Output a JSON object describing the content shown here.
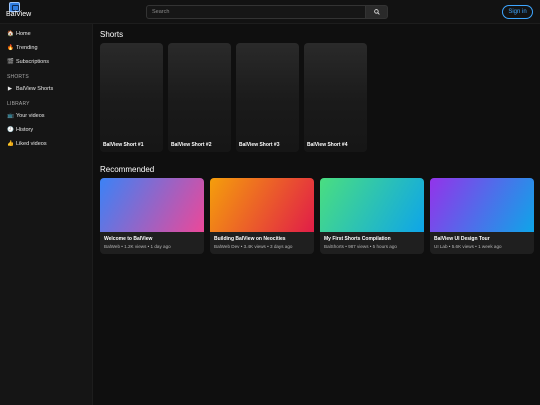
{
  "header": {
    "logo_text": "BalView",
    "search_placeholder": "Search",
    "signin_label": "Sign in"
  },
  "sidebar": {
    "items": [
      {
        "icon": "home-icon",
        "glyph": "🏠",
        "label": "Home"
      },
      {
        "icon": "fire-icon",
        "glyph": "🔥",
        "label": "Trending"
      },
      {
        "icon": "clapper-icon",
        "glyph": "🎬",
        "label": "Subscriptions"
      }
    ],
    "shorts_heading": "SHORTS",
    "shorts_items": [
      {
        "icon": "play-icon",
        "glyph": "▶",
        "label": "BalView Shorts"
      }
    ],
    "library_heading": "LIBRARY",
    "library_items": [
      {
        "icon": "tv-icon",
        "glyph": "📺",
        "label": "Your videos"
      },
      {
        "icon": "clock-icon",
        "glyph": "🕘",
        "label": "History"
      },
      {
        "icon": "thumbs-up-icon",
        "glyph": "👍",
        "label": "Liked videos"
      }
    ]
  },
  "main": {
    "shorts_title": "Shorts",
    "shorts": [
      {
        "title": "BalView Short #1"
      },
      {
        "title": "BalView Short #2"
      },
      {
        "title": "BalView Short #3"
      },
      {
        "title": "BalView Short #4"
      }
    ],
    "recommended_title": "Recommended",
    "videos": [
      {
        "title": "Welcome to BalView",
        "meta": "BalWeb • 1.2K views • 1 day ago",
        "gradient_from": "#3b82f6",
        "gradient_to": "#ec4899"
      },
      {
        "title": "Building BalView on Neocities",
        "meta": "BalWeb Dev • 3.4K views • 3 days ago",
        "gradient_from": "#f59e0b",
        "gradient_to": "#e11d48"
      },
      {
        "title": "My First Shorts Compilation",
        "meta": "BalShorts • 987 views • 5 hours ago",
        "gradient_from": "#4ade80",
        "gradient_to": "#0ea5e9"
      },
      {
        "title": "BalView UI Design Tour",
        "meta": "UI Lab • 5.6K views • 1 week ago",
        "gradient_from": "#9333ea",
        "gradient_to": "#0ea5e9"
      }
    ]
  },
  "colors": {
    "background": "#0f0f0f",
    "sidebar": "#151515",
    "accent": "#3ea6ff"
  }
}
